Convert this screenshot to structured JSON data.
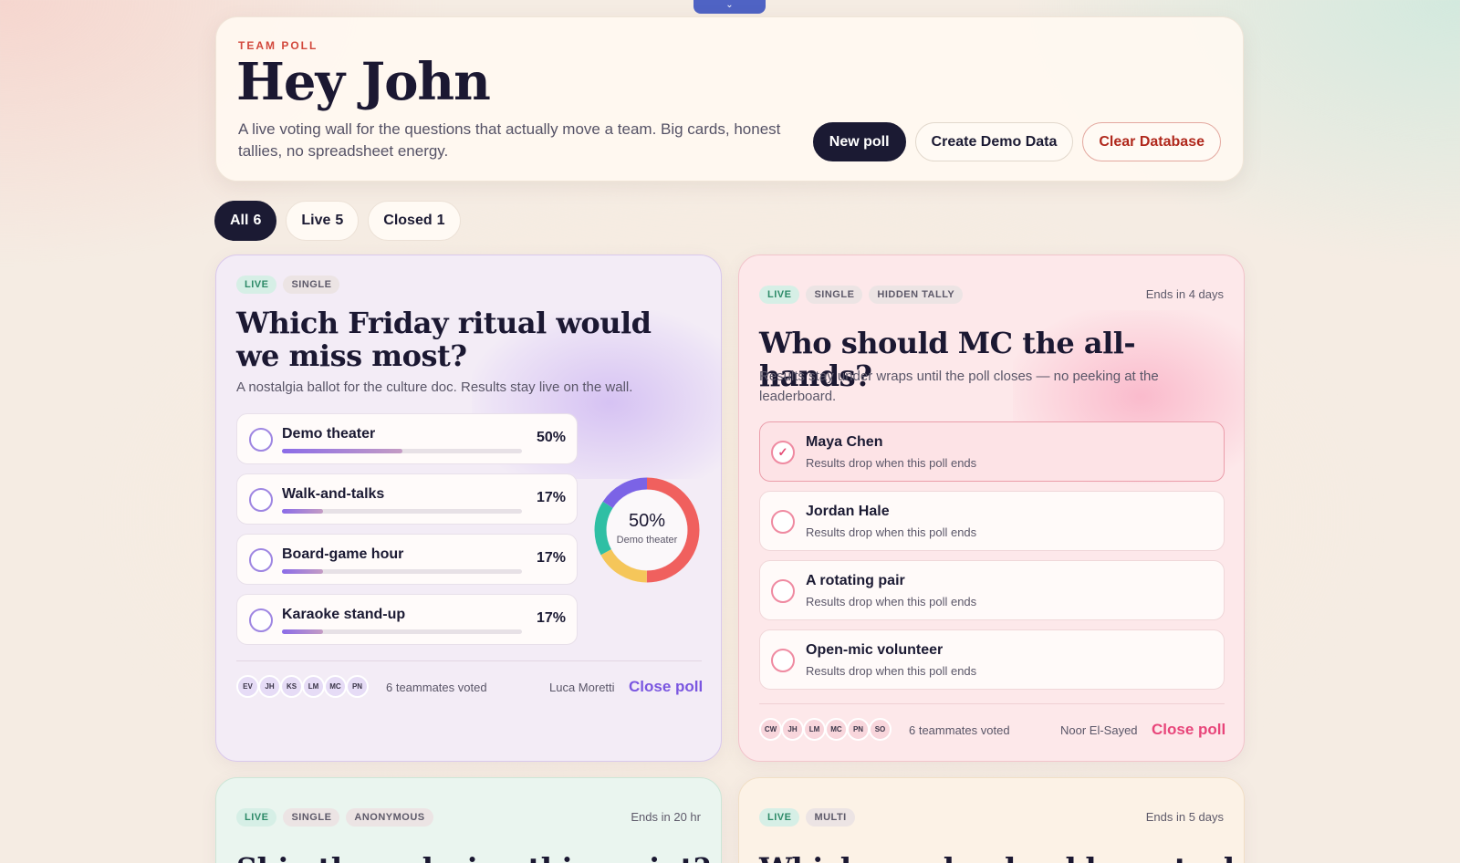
{
  "top_handle": {
    "icon": "chevron-down-icon",
    "glyph": "⌄"
  },
  "header": {
    "eyebrow": "TEAM POLL",
    "title": "Hey John",
    "subtitle": "A live voting wall for the questions that actually move a team. Big cards, honest tallies, no spreadsheet energy.",
    "actions": {
      "new_poll": "New poll",
      "demo_data": "Create Demo Data",
      "clear_db": "Clear Database"
    }
  },
  "filters": [
    {
      "label": "All",
      "count": "6",
      "active": true
    },
    {
      "label": "Live",
      "count": "5",
      "active": false
    },
    {
      "label": "Closed",
      "count": "1",
      "active": false
    }
  ],
  "polls": [
    {
      "tags": [
        "LIVE",
        "SINGLE"
      ],
      "title": "Which Friday ritual would we miss most?",
      "description": "A nostalgia ballot for the culture doc. Results stay live on the wall.",
      "options": [
        {
          "label": "Demo theater",
          "percent": "50%",
          "share": 0.5
        },
        {
          "label": "Walk-and-talks",
          "percent": "17%",
          "share": 0.17
        },
        {
          "label": "Board-game hour",
          "percent": "17%",
          "share": 0.17
        },
        {
          "label": "Karaoke stand-up",
          "percent": "17%",
          "share": 0.17
        }
      ],
      "donut": {
        "value": "50%",
        "caption": "Demo theater",
        "segments": [
          {
            "share": 0.5,
            "color": "#f0605e"
          },
          {
            "share": 0.17,
            "color": "#f5c65a"
          },
          {
            "share": 0.17,
            "color": "#2fbfa4"
          },
          {
            "share": 0.16,
            "color": "#7b63e6"
          }
        ]
      },
      "voters": [
        "EV",
        "JH",
        "KS",
        "LM",
        "MC",
        "PN"
      ],
      "voted_text": "6 teammates voted",
      "owner": "Luca Moretti",
      "close_label": "Close poll",
      "accent": "#7a56e0"
    },
    {
      "tags": [
        "LIVE",
        "SINGLE",
        "HIDDEN TALLY"
      ],
      "ends": "Ends in 4 days",
      "title": "Who should MC the all-hands?",
      "description": "Results stay under wraps until the poll closes — no peeking at the leaderboard.",
      "options": [
        {
          "label": "Maya Chen",
          "sub": "Results drop when this poll ends",
          "selected": true
        },
        {
          "label": "Jordan Hale",
          "sub": "Results drop when this poll ends",
          "selected": false
        },
        {
          "label": "A rotating pair",
          "sub": "Results drop when this poll ends",
          "selected": false
        },
        {
          "label": "Open-mic volunteer",
          "sub": "Results drop when this poll ends",
          "selected": false
        }
      ],
      "voters": [
        "CW",
        "JH",
        "LM",
        "MC",
        "PN",
        "SO"
      ],
      "voted_text": "6 teammates voted",
      "owner": "Noor El-Sayed",
      "close_label": "Close poll",
      "accent": "#e8457a"
    },
    {
      "tags": [
        "LIVE",
        "SINGLE",
        "ANONYMOUS"
      ],
      "ends": "Ends in 20 hr",
      "title": "Ship the redesign this sprint?"
    },
    {
      "tags": [
        "LIVE",
        "MULTI"
      ],
      "ends": "Ends in 5 days",
      "title": "Which snacks should we stock next"
    }
  ]
}
